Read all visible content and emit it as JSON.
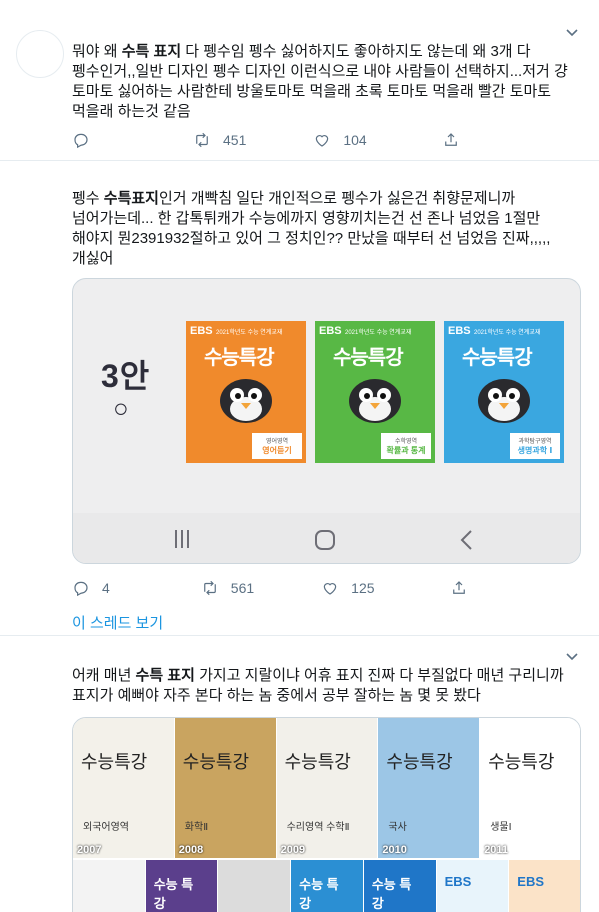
{
  "tweets": [
    {
      "text_parts": [
        {
          "t": "뭐야 왜 ",
          "b": false
        },
        {
          "t": "수특 표지",
          "b": true
        },
        {
          "t": " 다 펭수임 펭수 싫어하지도 좋아하지도 않는데 왜 3개 다 펭수인거,,일반 디자인 펭수 디자인 이런식으로 내야 사람들이 선택하지...저거 걍 토마토 싫어하는 사람한테 방울토마토 먹을래 초록 토마토 먹을래 빨간 토마토 먹을래 하는것 같음",
          "b": false
        }
      ],
      "reply_count": "",
      "retweet_count": "451",
      "like_count": "104"
    },
    {
      "text_parts": [
        {
          "t": "펭수 ",
          "b": false
        },
        {
          "t": "수특표지",
          "b": true
        },
        {
          "t": "인거 개빡침 일단 개인적으로 펭수가 싫은건 취향문제니까 넘어가는데... 한 갑톡튀캐가 수능에까지 영향끼치는건 선 존나 넘었음 1절만 해야지 뭔2391932절하고 있어 그 정치인?? 만났을 때부터 선 넘었음 진짜,,,,,개싫어",
          "b": false
        }
      ],
      "media": {
        "left_big": "3안",
        "left_mark": "○",
        "books": [
          {
            "brand": "EBS",
            "series": "2021학년도 수능 연계교재",
            "title": "수능특강",
            "subject_small": "영어영역",
            "subject": "영어듣기",
            "color": "#f08a2c"
          },
          {
            "brand": "EBS",
            "series": "2021학년도 수능 연계교재",
            "title": "수능특강",
            "subject_small": "수학영역",
            "subject": "확률과 통계",
            "color": "#58b845"
          },
          {
            "brand": "EBS",
            "series": "2021학년도 수능 연계교재",
            "title": "수능특강",
            "subject_small": "과학탐구영역",
            "subject": "생명과학 Ⅰ",
            "color": "#3aa7e0"
          }
        ]
      },
      "reply_count": "4",
      "retweet_count": "561",
      "like_count": "125",
      "thread_link": "이 스레드 보기"
    },
    {
      "text_parts": [
        {
          "t": "어캐 매년 ",
          "b": false
        },
        {
          "t": "수특 표지",
          "b": true
        },
        {
          "t": " 가지고 지랄이냐 어휴 표지 진짜 다 부질없다 매년 구리니까  표지가 예뻐야 자주 본다 하는 놈 중에서 공부 잘하는 놈 몇 못 봤다",
          "b": false
        }
      ],
      "collage": {
        "covers": [
          {
            "year": "2007",
            "title": "수능특강",
            "sub": "외국어영역",
            "bg": "#f3f1ea"
          },
          {
            "year": "2008",
            "title": "수능특강",
            "sub": "화학Ⅱ",
            "bg": "#c9a460"
          },
          {
            "year": "2009",
            "title": "수능특강",
            "sub": "수리영역 수학Ⅱ",
            "bg": "#f2f0ea"
          },
          {
            "year": "2010",
            "title": "수능특강",
            "sub": "국사",
            "bg": "#9cc6e6"
          },
          {
            "year": "2011",
            "title": "수능특강",
            "sub": "생물Ⅰ",
            "bg": "#ffffff"
          }
        ],
        "small": [
          {
            "title": "",
            "bg": "#f3f3f3"
          },
          {
            "title": "수능 특강",
            "bg": "#5b3f8c"
          },
          {
            "title": "",
            "bg": "#dcdcdc"
          },
          {
            "title": "수능 특강",
            "bg": "#2b8fd3"
          },
          {
            "title": "수능 특강",
            "bg": "#1f76c8"
          },
          {
            "title": "EBS",
            "bg": "#e8f4fb"
          },
          {
            "title": "EBS",
            "bg": "#fbe3c8"
          }
        ]
      }
    }
  ]
}
